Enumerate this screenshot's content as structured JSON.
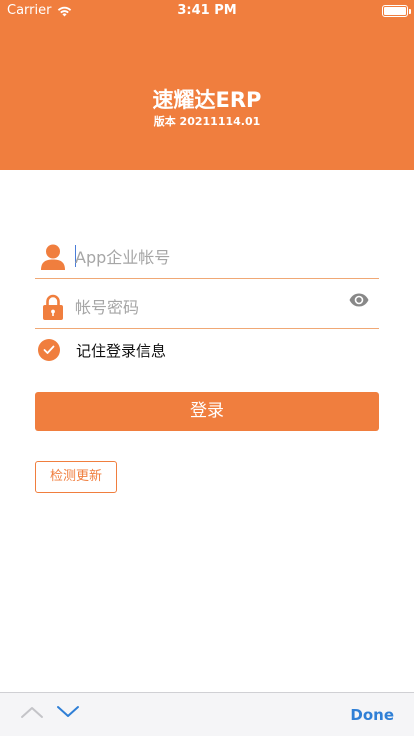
{
  "status_bar": {
    "carrier": "Carrier",
    "time": "3:41 PM",
    "battery_level": 1.0
  },
  "header": {
    "title": "速耀达ERP",
    "version": "版本 20211114.01",
    "bg_color": "#F07E3E"
  },
  "form": {
    "username": {
      "placeholder": "App企业帐号",
      "value": "",
      "icon": "user-icon"
    },
    "password": {
      "placeholder": "帐号密码",
      "value": "",
      "icon": "lock-icon",
      "toggle_icon": "eye-icon"
    },
    "remember": {
      "label": "记住登录信息",
      "checked": true
    }
  },
  "buttons": {
    "login": "登录",
    "check_update": "检测更新"
  },
  "keyboard_toolbar": {
    "done": "Done",
    "prev_icon": "chevron-up-icon",
    "next_icon": "chevron-down-icon"
  },
  "colors": {
    "accent": "#F07E3E",
    "link": "#2f7fd6"
  }
}
